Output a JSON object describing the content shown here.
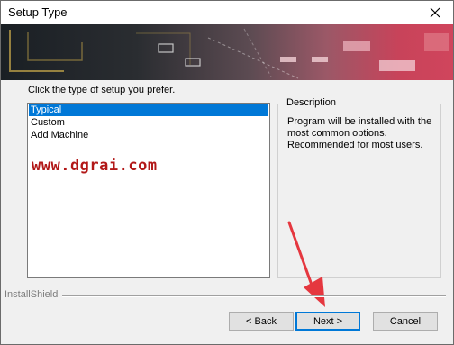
{
  "window": {
    "title": "Setup Type"
  },
  "instruction": "Click the type of setup you prefer.",
  "setup_types": [
    {
      "label": "Typical",
      "selected": true
    },
    {
      "label": "Custom",
      "selected": false
    },
    {
      "label": "Add Machine",
      "selected": false
    }
  ],
  "description": {
    "legend": "Description",
    "text": "Program will be installed with the most common options. Recommended for most users."
  },
  "watermark": "www.dgrai.com",
  "footer": {
    "brand": "InstallShield"
  },
  "buttons": {
    "back": "< Back",
    "next": "Next >",
    "cancel": "Cancel"
  },
  "colors": {
    "selection": "#0078d7",
    "annotation_arrow": "#e5373f",
    "watermark": "#b21818"
  },
  "icons": {
    "close": "close-icon",
    "annotation": "arrow-annotation"
  }
}
